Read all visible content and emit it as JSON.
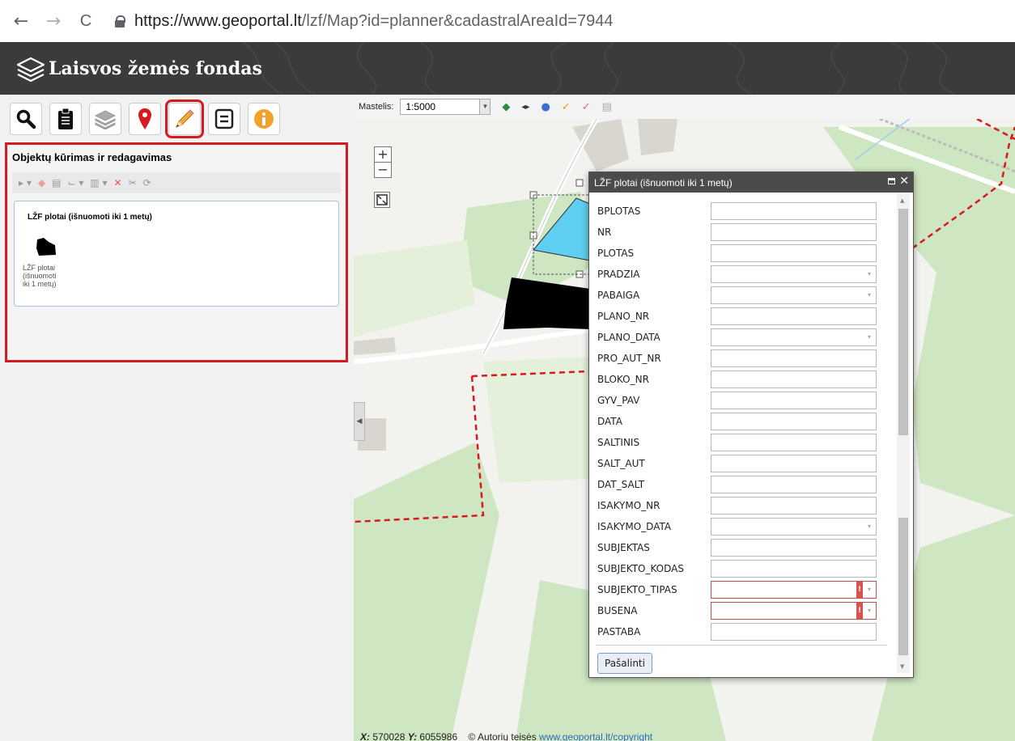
{
  "browser": {
    "back_label": "←",
    "forward_label": "→",
    "reload_label": "C",
    "url_host": "https://www.geoportal.lt",
    "url_path": "/lzf/Map?id=planner&cadastralAreaId=7944"
  },
  "app": {
    "title": "Laisvos žemės fondas"
  },
  "toolbar": {
    "active_tool": "edit"
  },
  "edit_panel": {
    "title": "Objektų kūrimas ir redagavimas",
    "template_name": "LŽF plotai (išnuomoti iki 1 metų)",
    "template_label": "LŽF plotai (išnuomoti iki 1 metų)"
  },
  "map": {
    "scale_label": "Mastelis:",
    "scale_value": "1:5000",
    "zoom_in": "+",
    "zoom_out": "−",
    "coord_x_label": "X:",
    "coord_x": "570028",
    "coord_y_label": "Y:",
    "coord_y": "6055986",
    "copyright_text": "© Autorių teisės",
    "copyright_link": "www.geoportal.lt/copyright"
  },
  "dialog": {
    "title": "LŽF plotai (išnuomoti iki 1 metų)",
    "fields": [
      {
        "label": "BPLOTAS",
        "type": "text"
      },
      {
        "label": "NR",
        "type": "text"
      },
      {
        "label": "PLOTAS",
        "type": "text"
      },
      {
        "label": "PRADZIA",
        "type": "date"
      },
      {
        "label": "PABAIGA",
        "type": "date"
      },
      {
        "label": "PLANO_NR",
        "type": "text"
      },
      {
        "label": "PLANO_DATA",
        "type": "date"
      },
      {
        "label": "PRO_AUT_NR",
        "type": "text"
      },
      {
        "label": "BLOKO_NR",
        "type": "text"
      },
      {
        "label": "GYV_PAV",
        "type": "text"
      },
      {
        "label": "DATA",
        "type": "text"
      },
      {
        "label": "SALTINIS",
        "type": "text"
      },
      {
        "label": "SALT_AUT",
        "type": "text"
      },
      {
        "label": "DAT_SALT",
        "type": "text"
      },
      {
        "label": "ISAKYMO_NR",
        "type": "text"
      },
      {
        "label": "ISAKYMO_DATA",
        "type": "date"
      },
      {
        "label": "SUBJEKTAS",
        "type": "text"
      },
      {
        "label": "SUBJEKTO_KODAS",
        "type": "text"
      },
      {
        "label": "SUBJEKTO_TIPAS",
        "type": "select-invalid"
      },
      {
        "label": "BUSENA",
        "type": "select-invalid"
      },
      {
        "label": "PASTABA",
        "type": "text"
      }
    ],
    "delete_button": "Pašalinti",
    "error_mark": "!"
  },
  "colors": {
    "header_bg": "#3b3b3b",
    "highlight_red": "#d71920",
    "selected_parcel": "#5ecff0",
    "parcel_black": "#000000",
    "boundary_red": "#d71920"
  }
}
